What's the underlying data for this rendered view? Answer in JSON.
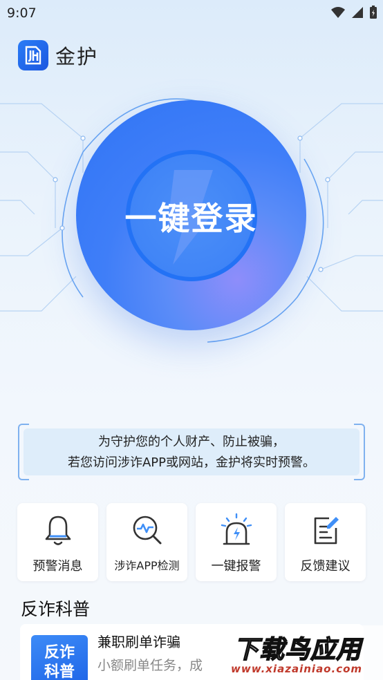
{
  "status_bar": {
    "time": "9:07"
  },
  "header": {
    "app_name": "金护",
    "logo_text": "JH"
  },
  "hero": {
    "login_label": "一键登录"
  },
  "notice": {
    "line1": "为守护您的个人财产、防止被骗，",
    "line2": "若您访问涉诈APP或网站，金护将实时预警。"
  },
  "features": [
    {
      "label": "预警消息",
      "icon": "bell-icon"
    },
    {
      "label": "涉诈APP检测",
      "icon": "scan-magnifier-icon"
    },
    {
      "label": "一键报警",
      "icon": "alarm-siren-icon"
    },
    {
      "label": "反馈建议",
      "icon": "feedback-edit-icon"
    }
  ],
  "section": {
    "title": "反诈科普"
  },
  "article": {
    "thumb_line1": "反诈",
    "thumb_line2": "科普",
    "title": "兼职刷单诈骗",
    "desc": "小额刷单任务，成"
  },
  "watermark": {
    "main": "下载鸟应用",
    "sub": "www.xiazainiao.com"
  },
  "colors": {
    "accent": "#2f74f5",
    "brand_blue": "#1c57e0"
  }
}
